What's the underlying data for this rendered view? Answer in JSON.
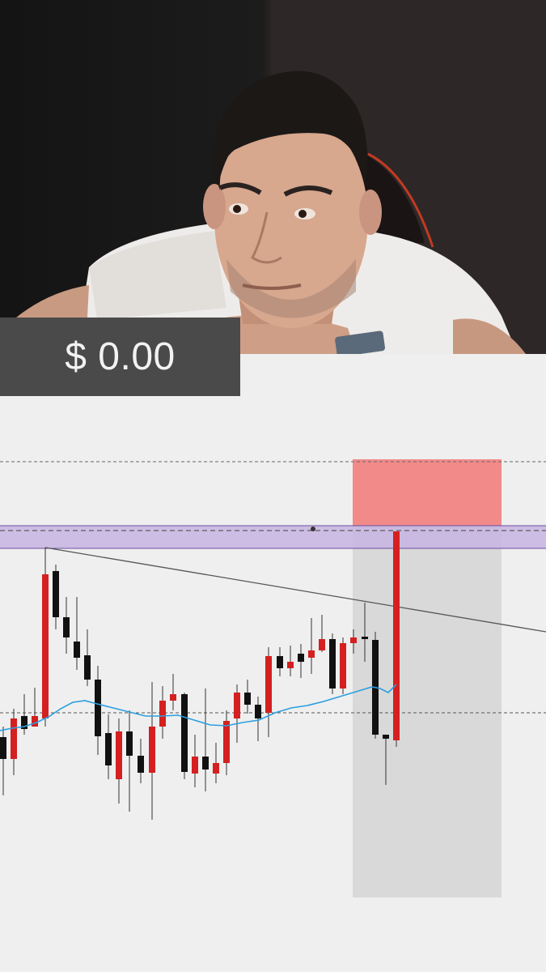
{
  "overlay": {
    "balance": "$ 0.00"
  },
  "colors": {
    "bull_candle": "#d42020",
    "bear_candle": "#111111",
    "moving_average": "#2b9fe0",
    "resistance_zone": "#c7b3e0",
    "stop_zone": "#f28a8a",
    "target_zone": "#d9d9d9",
    "trendline": "#555555",
    "chart_background": "#efefef",
    "balance_box": "#4a4a4a"
  },
  "icons": {
    "webcam_subject": "person-icon"
  }
}
